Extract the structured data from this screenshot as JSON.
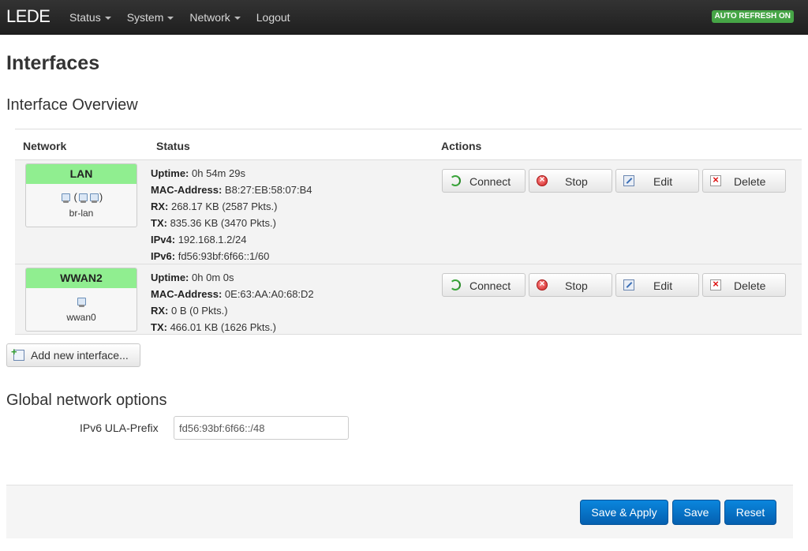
{
  "navbar": {
    "brand": "LEDE",
    "menu": [
      {
        "label": "Status",
        "has_dropdown": true
      },
      {
        "label": "System",
        "has_dropdown": true
      },
      {
        "label": "Network",
        "has_dropdown": true
      },
      {
        "label": "Logout",
        "has_dropdown": false
      }
    ],
    "refresh_badge": "AUTO REFRESH ON",
    "badge_color": "#46a546"
  },
  "page": {
    "title": "Interfaces",
    "overview_title": "Interface Overview"
  },
  "table": {
    "headers": {
      "network": "Network",
      "status": "Status",
      "actions": "Actions"
    },
    "rows": [
      {
        "name": "LAN",
        "device": "br-lan",
        "icons_note": "(",
        "icons_note_close": ")",
        "status": [
          {
            "label": "Uptime:",
            "value": "0h 54m 29s"
          },
          {
            "label": "MAC-Address:",
            "value": "B8:27:EB:58:07:B4"
          },
          {
            "label": "RX:",
            "value": "268.17 KB (2587 Pkts.)"
          },
          {
            "label": "TX:",
            "value": "835.36 KB (3470 Pkts.)"
          },
          {
            "label": "IPv4:",
            "value": "192.168.1.2/24"
          },
          {
            "label": "IPv6:",
            "value": "fd56:93bf:6f66::1/60"
          }
        ]
      },
      {
        "name": "WWAN2",
        "device": "wwan0",
        "status": [
          {
            "label": "Uptime:",
            "value": "0h 0m 0s"
          },
          {
            "label": "MAC-Address:",
            "value": "0E:63:AA:A0:68:D2"
          },
          {
            "label": "RX:",
            "value": "0 B (0 Pkts.)"
          },
          {
            "label": "TX:",
            "value": "466.01 KB (1626 Pkts.)"
          }
        ]
      }
    ],
    "actions": {
      "connect": "Connect",
      "stop": "Stop",
      "edit": "Edit",
      "delete": "Delete"
    },
    "header_color": "#90ee90"
  },
  "add_interface_label": "Add new interface...",
  "global": {
    "title": "Global network options",
    "ula_label": "IPv6 ULA-Prefix",
    "ula_value": "fd56:93bf:6f66::/48"
  },
  "footer": {
    "save_apply": "Save & Apply",
    "save": "Save",
    "reset": "Reset",
    "button_color": "#0a74c8"
  }
}
